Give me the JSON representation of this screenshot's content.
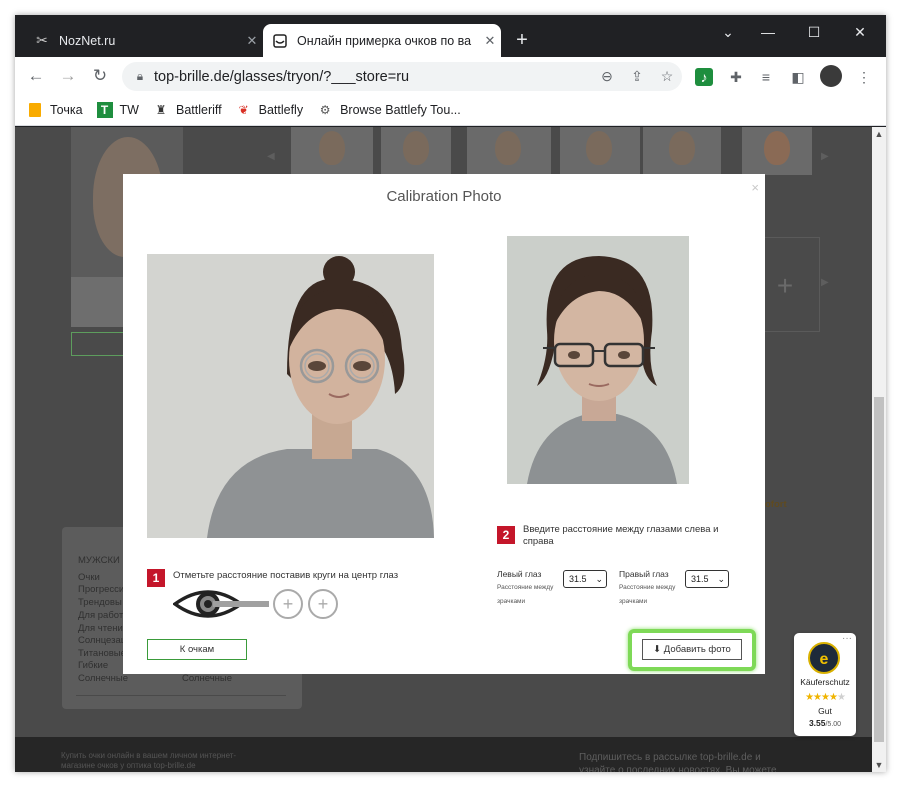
{
  "tabs": [
    {
      "title": "NozNet.ru",
      "icon": "tools-icon"
    },
    {
      "title": "Онлайн примерка очков по ва",
      "icon": "brille-icon"
    }
  ],
  "address": {
    "url": "top-brille.de/glasses/tryon/?___store=ru"
  },
  "bookmarks": [
    {
      "label": "Точка",
      "icon": "folder-icon",
      "color": "#f9ab00"
    },
    {
      "label": "TW",
      "icon": "tw-icon",
      "color": "#1e8e3e"
    },
    {
      "label": "Battleriff",
      "icon": "battleriff-icon",
      "color": "#333333"
    },
    {
      "label": "Battlefly",
      "icon": "battlefly-icon",
      "color": "#d93025"
    },
    {
      "label": "Browse Battlefy Tou...",
      "icon": "battlefy-icon",
      "color": "#555555"
    }
  ],
  "modal": {
    "title": "Calibration Photo",
    "close": "×",
    "step1": {
      "num": "1",
      "text": "Отметьте расстояние поставив круги на центр глаз"
    },
    "step2": {
      "num": "2",
      "text": "Введите расстояние между глазами слева и справа"
    },
    "left": {
      "label": "Левый глаз",
      "sub": "Расстояние между зрачками",
      "value": "31.5"
    },
    "right": {
      "label": "Правый глаз",
      "sub": "Расстояние между зрачками",
      "value": "31.5"
    },
    "btn_glasses": "К очкам",
    "btn_add_photo": "Добавить фото"
  },
  "background": {
    "sidebar_heading": "МУЖСКИ",
    "sidebar_items": [
      "Очки",
      "Прогресси",
      "Трендовы",
      "Для работ",
      "Для чтени",
      "Солнцезащ",
      "Титановые",
      "Гибкие",
      "Солнечные"
    ],
    "sidebar_item_right": "Солнечные",
    "brand_fragment": "ofort",
    "footer_left": "Купить очки онлайн в вашем личном интернет-магазине очков у оптика top-brille.de",
    "footer_right": "Подпишитесь в рассылке top-brille.de и узнайте о последних новостях. Вы можете отозвать свое согласие в любое время."
  },
  "trustbadge": {
    "label": "Käuferschutz",
    "rating_text": "Gut",
    "score": "3.55",
    "max": "/5.00",
    "stars": 4
  },
  "colors": {
    "accent_red": "#c4162a",
    "highlight_green": "#7ed957"
  }
}
